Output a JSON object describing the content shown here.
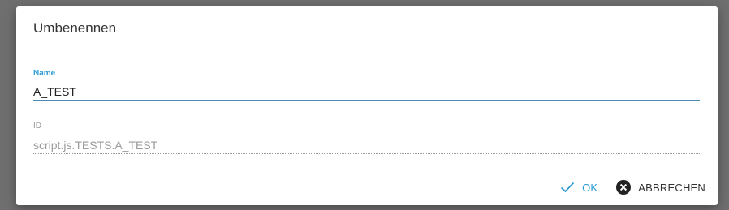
{
  "dialog": {
    "title": "Umbenennen",
    "name_field": {
      "label": "Name",
      "value": "A_TEST"
    },
    "id_field": {
      "label": "ID",
      "value": "script.js.TESTS.A_TEST"
    },
    "buttons": {
      "ok_label": "OK",
      "ok_icon": "checkmark-icon",
      "cancel_label": "ABBRECHEN",
      "cancel_icon": "close-circle-icon"
    },
    "colors": {
      "accent": "#2f9cd3",
      "overlay": "#6f6f6f"
    }
  }
}
